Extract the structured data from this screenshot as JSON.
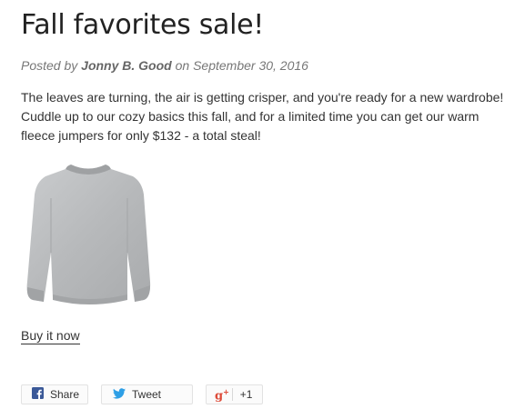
{
  "post": {
    "title": "Fall favorites sale!",
    "posted_by_prefix": "Posted by",
    "author": "Jonny B. Good",
    "date_prefix": "on",
    "date": "September 30, 2016",
    "body": "The leaves are turning, the air is getting crisper, and you're ready for a new wardrobe! Cuddle up to our cozy basics this fall, and for a limited time you can get our warm fleece jumpers for only $132 - a total steal!",
    "image_subject": "grey sweatshirt",
    "buy_link": "Buy it now"
  },
  "share": {
    "facebook_label": "Share",
    "twitter_label": "Tweet",
    "google_label": "+1",
    "facebook_icon": "facebook-icon",
    "twitter_icon": "twitter-icon",
    "google_icon": "google-plus-icon"
  },
  "colors": {
    "facebook": "#3b5998",
    "twitter": "#2e9fe6",
    "google": "#dd4b39"
  }
}
